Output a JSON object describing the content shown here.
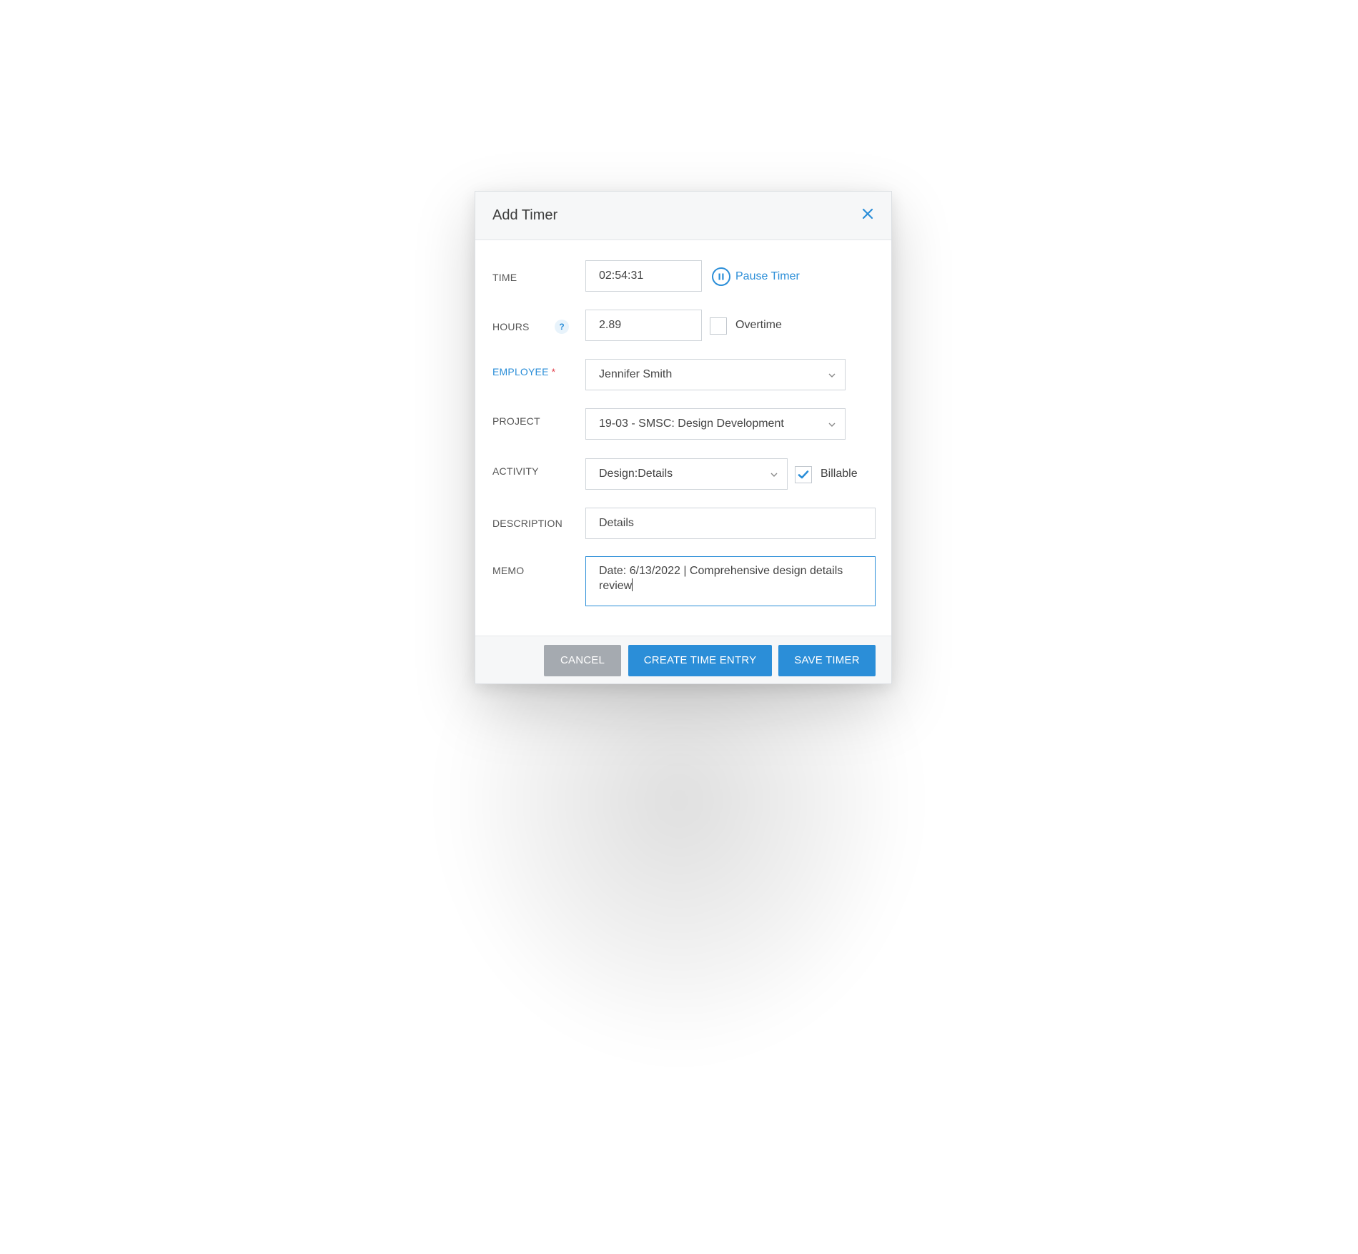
{
  "dialog": {
    "title": "Add Timer"
  },
  "form": {
    "time": {
      "label": "TIME",
      "value": "02:54:31"
    },
    "pause_timer": {
      "label": "Pause Timer"
    },
    "hours": {
      "label": "HOURS",
      "help_glyph": "?",
      "value": "2.89"
    },
    "overtime": {
      "label": "Overtime",
      "checked": false
    },
    "employee": {
      "label": "EMPLOYEE",
      "required_mark": "*",
      "value": "Jennifer Smith"
    },
    "project": {
      "label": "PROJECT",
      "value": "19-03 - SMSC: Design Development"
    },
    "activity": {
      "label": "ACTIVITY",
      "value": "Design:Details"
    },
    "billable": {
      "label": "Billable",
      "checked": true
    },
    "description": {
      "label": "DESCRIPTION",
      "value": "Details"
    },
    "memo": {
      "label": "MEMO",
      "value": "Date: 6/13/2022 | Comprehensive design details review"
    }
  },
  "footer": {
    "cancel_label": "CANCEL",
    "create_label": "CREATE TIME ENTRY",
    "save_label": "SAVE TIMER"
  },
  "colors": {
    "accent": "#2b8ed8",
    "cancel": "#a5aab0",
    "required": "#e2424e"
  },
  "icons": {
    "close": "close-icon",
    "pause": "pause-circle-icon",
    "help": "help-icon",
    "chevron": "chevron-down-icon",
    "check": "checkmark-icon"
  }
}
